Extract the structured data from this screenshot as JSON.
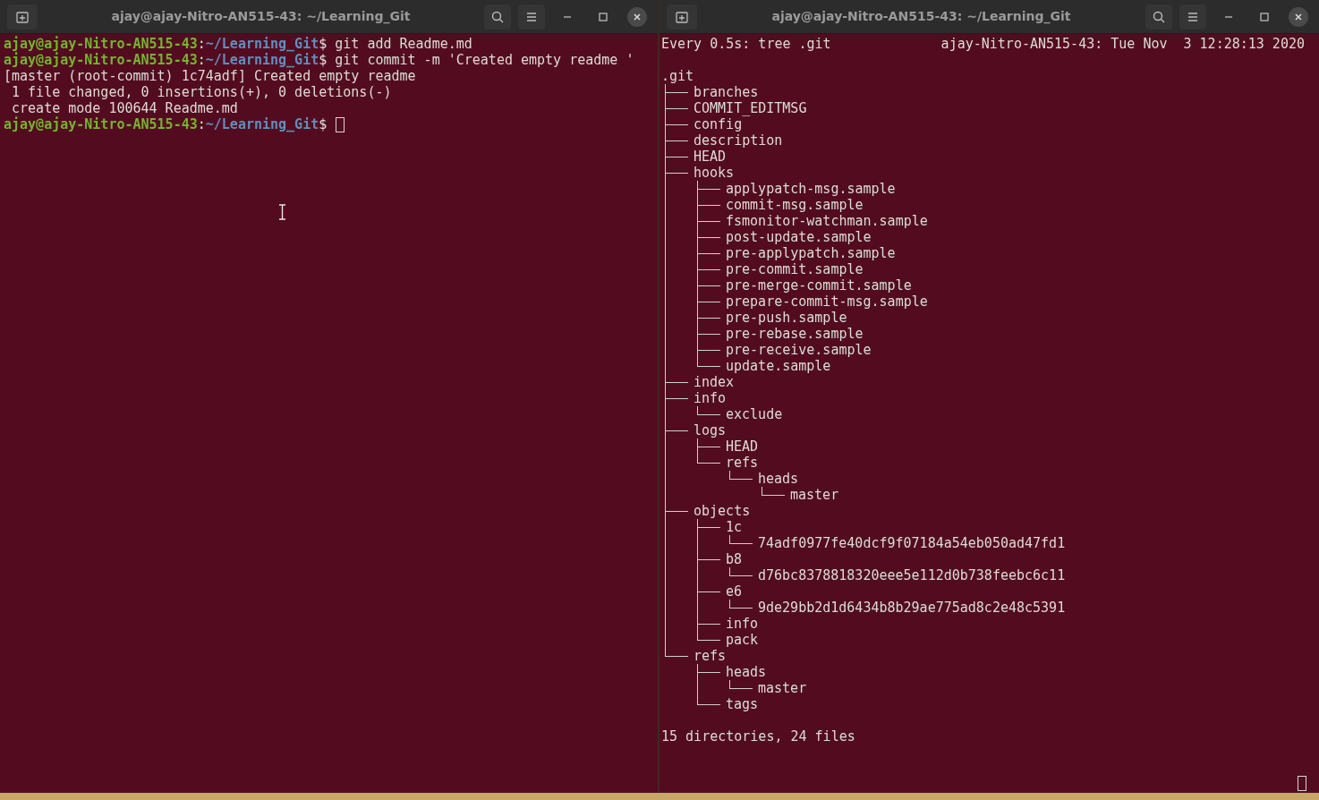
{
  "windows": [
    {
      "title": "ajay@ajay-Nitro-AN515-43: ~/Learning_Git",
      "kind": "shell",
      "lines": [
        {
          "kind": "prompt",
          "user": "ajay@ajay-Nitro-AN515-43",
          "separator": ":",
          "path": "~/Learning_Git",
          "symbol": "$",
          "command": "git add Readme.md"
        },
        {
          "kind": "prompt",
          "user": "ajay@ajay-Nitro-AN515-43",
          "separator": ":",
          "path": "~/Learning_Git",
          "symbol": "$",
          "command": "git commit -m 'Created empty readme '"
        },
        {
          "kind": "output",
          "text": "[master (root-commit) 1c74adf] Created empty readme"
        },
        {
          "kind": "output",
          "text": " 1 file changed, 0 insertions(+), 0 deletions(-)"
        },
        {
          "kind": "output",
          "text": " create mode 100644 Readme.md"
        },
        {
          "kind": "prompt",
          "user": "ajay@ajay-Nitro-AN515-43",
          "separator": ":",
          "path": "~/Learning_Git",
          "symbol": "$",
          "cursor": true
        }
      ]
    },
    {
      "title": "ajay@ajay-Nitro-AN515-43: ~/Learning_Git",
      "kind": "watch",
      "header_left": "Every 0.5s: tree .git",
      "header_right": "ajay-Nitro-AN515-43: Tue Nov  3 12:28:13 2020",
      "cursor": true,
      "tree": {
        "name": ".git",
        "children": [
          {
            "name": "branches"
          },
          {
            "name": "COMMIT_EDITMSG"
          },
          {
            "name": "config"
          },
          {
            "name": "description"
          },
          {
            "name": "HEAD"
          },
          {
            "name": "hooks",
            "children": [
              {
                "name": "applypatch-msg.sample"
              },
              {
                "name": "commit-msg.sample"
              },
              {
                "name": "fsmonitor-watchman.sample"
              },
              {
                "name": "post-update.sample"
              },
              {
                "name": "pre-applypatch.sample"
              },
              {
                "name": "pre-commit.sample"
              },
              {
                "name": "pre-merge-commit.sample"
              },
              {
                "name": "prepare-commit-msg.sample"
              },
              {
                "name": "pre-push.sample"
              },
              {
                "name": "pre-rebase.sample"
              },
              {
                "name": "pre-receive.sample"
              },
              {
                "name": "update.sample"
              }
            ]
          },
          {
            "name": "index"
          },
          {
            "name": "info",
            "children": [
              {
                "name": "exclude"
              }
            ]
          },
          {
            "name": "logs",
            "children": [
              {
                "name": "HEAD"
              },
              {
                "name": "refs",
                "children": [
                  {
                    "name": "heads",
                    "children": [
                      {
                        "name": "master"
                      }
                    ]
                  }
                ]
              }
            ]
          },
          {
            "name": "objects",
            "children": [
              {
                "name": "1c",
                "children": [
                  {
                    "name": "74adf0977fe40dcf9f07184a54eb050ad47fd1"
                  }
                ]
              },
              {
                "name": "b8",
                "children": [
                  {
                    "name": "d76bc8378818320eee5e112d0b738feebc6c11"
                  }
                ]
              },
              {
                "name": "e6",
                "children": [
                  {
                    "name": "9de29bb2d1d6434b8b29ae775ad8c2e48c5391"
                  }
                ]
              },
              {
                "name": "info"
              },
              {
                "name": "pack"
              }
            ]
          },
          {
            "name": "refs",
            "children": [
              {
                "name": "heads",
                "children": [
                  {
                    "name": "master"
                  }
                ]
              },
              {
                "name": "tags"
              }
            ]
          }
        ]
      },
      "summary": "15 directories, 24 files"
    }
  ]
}
